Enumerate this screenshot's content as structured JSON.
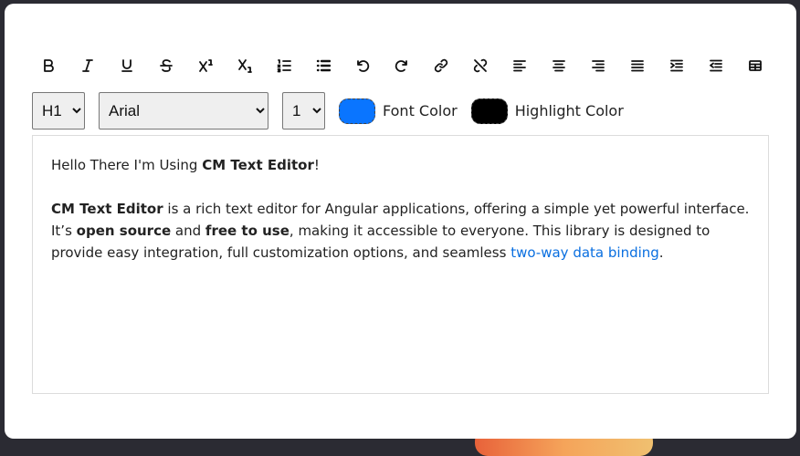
{
  "toolbar": {
    "items": [
      {
        "name": "bold-button",
        "icon": "bold-icon",
        "glyph": "B"
      },
      {
        "name": "italic-button",
        "icon": "italic-icon",
        "glyph": "I"
      },
      {
        "name": "underline-button",
        "icon": "underline-icon",
        "glyph": "U"
      },
      {
        "name": "strikethrough-button",
        "icon": "strikethrough-icon",
        "glyph": "S"
      },
      {
        "name": "superscript-button",
        "icon": "superscript-icon",
        "glyph": "X¹"
      },
      {
        "name": "subscript-button",
        "icon": "subscript-icon",
        "glyph": "X₁"
      },
      {
        "name": "ordered-list-button",
        "icon": "ordered-list-icon"
      },
      {
        "name": "unordered-list-button",
        "icon": "unordered-list-icon"
      },
      {
        "name": "undo-button",
        "icon": "undo-icon"
      },
      {
        "name": "redo-button",
        "icon": "redo-icon"
      },
      {
        "name": "link-button",
        "icon": "link-icon"
      },
      {
        "name": "unlink-button",
        "icon": "unlink-icon"
      },
      {
        "name": "align-left-button",
        "icon": "align-left-icon"
      },
      {
        "name": "align-center-button",
        "icon": "align-center-icon"
      },
      {
        "name": "align-right-button",
        "icon": "align-right-icon"
      },
      {
        "name": "align-justify-button",
        "icon": "align-justify-icon"
      },
      {
        "name": "indent-button",
        "icon": "indent-icon"
      },
      {
        "name": "outdent-button",
        "icon": "outdent-icon"
      },
      {
        "name": "table-button",
        "icon": "table-icon"
      }
    ]
  },
  "controls": {
    "heading_value": "H1",
    "font_value": "Arial",
    "size_value": "1",
    "font_color_label": "Font Color",
    "font_color": "#0a75ff",
    "highlight_color_label": "Highlight Color",
    "highlight_color": "#000000"
  },
  "content": {
    "p1_a": "Hello There I'm Using ",
    "p1_b": "CM Text Editor",
    "p1_c": "!",
    "p2_a": "CM Text Editor",
    "p2_b": " is a rich text editor for Angular applications, offering a simple yet powerful interface. It’s ",
    "p2_c": "open source",
    "p2_d": " and ",
    "p2_e": "free to use",
    "p2_f": ", making it accessible to everyone. This library is designed to provide easy integration, full customization options, and seamless ",
    "p2_link": "two-way data binding",
    "p2_g": "."
  }
}
